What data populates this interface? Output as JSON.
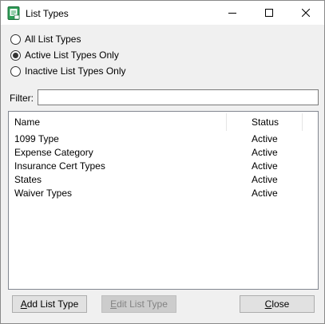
{
  "window": {
    "title": "List Types"
  },
  "options": [
    {
      "label": "All List Types",
      "checked": false
    },
    {
      "label": "Active List Types Only",
      "checked": true
    },
    {
      "label": "Inactive List Types Only",
      "checked": false
    }
  ],
  "filter": {
    "label": "Filter:",
    "value": ""
  },
  "list": {
    "columns": [
      "Name",
      "Status"
    ],
    "rows": [
      [
        "1099 Type",
        "Active"
      ],
      [
        "Expense Category",
        "Active"
      ],
      [
        "Insurance Cert Types",
        "Active"
      ],
      [
        "States",
        "Active"
      ],
      [
        "Waiver Types",
        "Active"
      ]
    ]
  },
  "buttons": {
    "add": {
      "mnemonic": "A",
      "rest": "dd List Type"
    },
    "edit": {
      "mnemonic": "E",
      "rest": "dit List Type"
    },
    "close": {
      "mnemonic": "C",
      "rest": "lose"
    }
  }
}
